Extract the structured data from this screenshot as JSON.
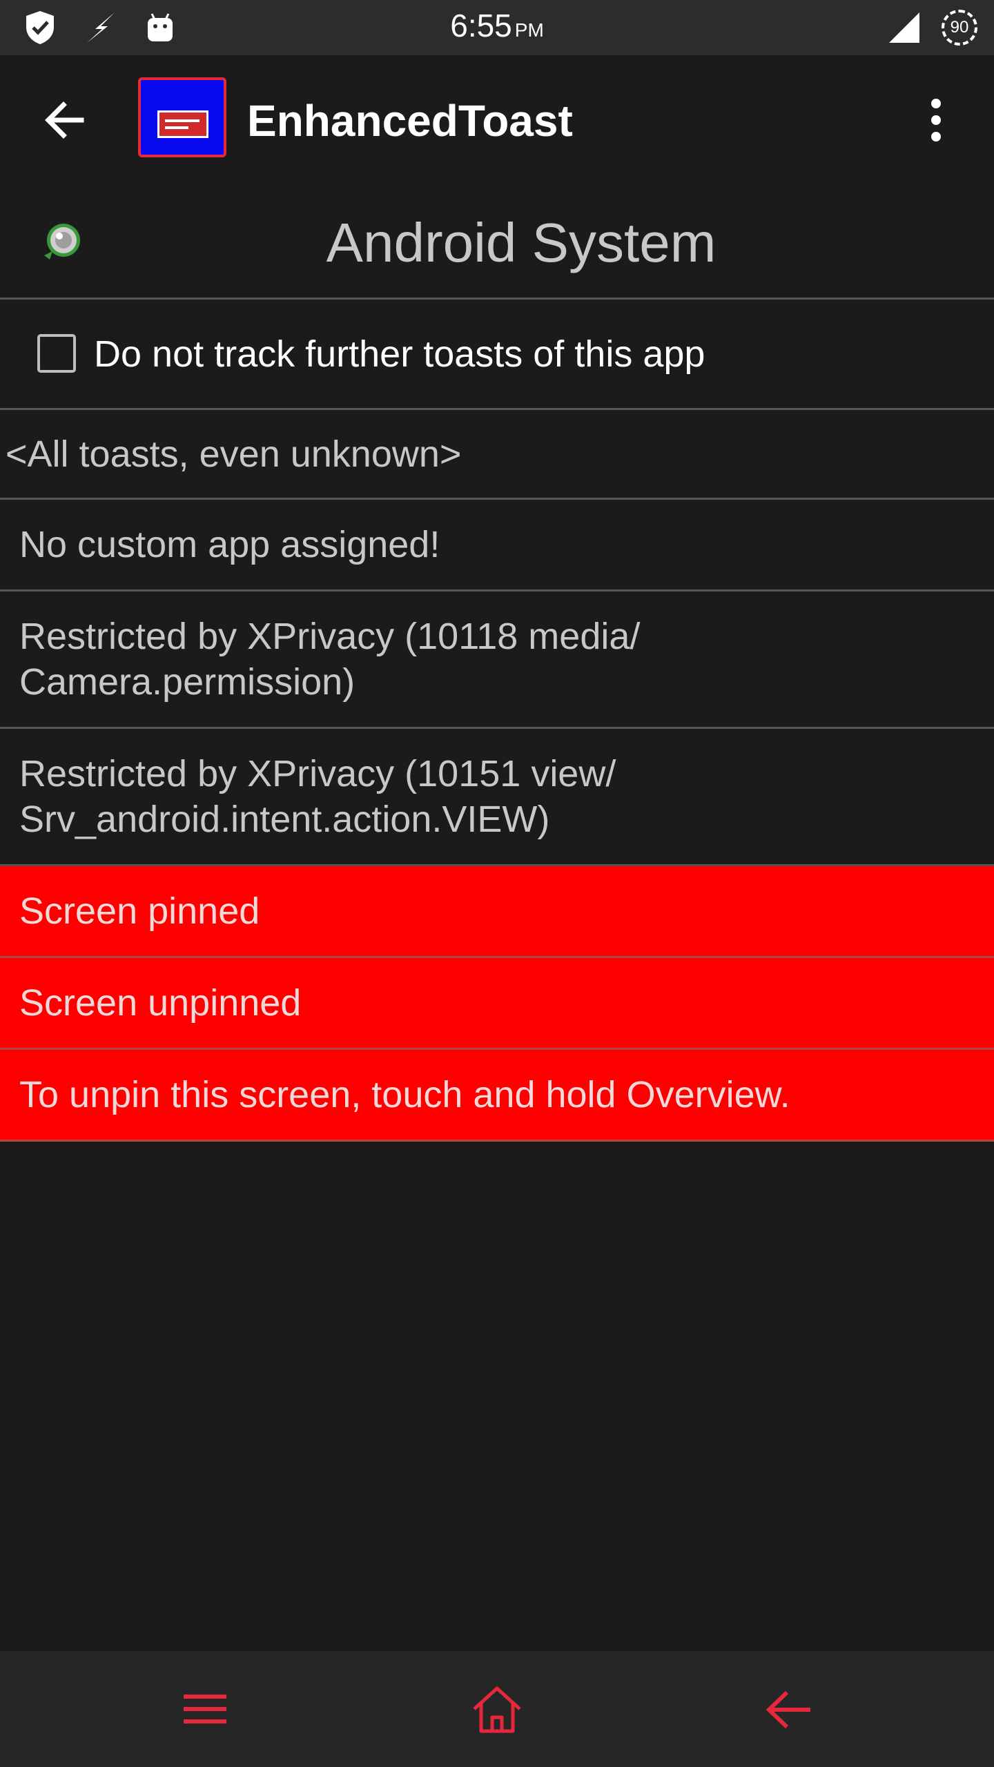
{
  "status_bar": {
    "time": "6:55",
    "ampm": "PM",
    "battery": "90",
    "icons": [
      "shield-check-icon",
      "lightning-icon",
      "android-icon",
      "cell-signal-icon",
      "battery-icon"
    ]
  },
  "app_bar": {
    "title": "EnhancedToast",
    "back_icon": "arrow-back-icon",
    "overflow_icon": "more-vert-icon"
  },
  "header": {
    "title": "Android System",
    "icon": "android-system-icon"
  },
  "tracking": {
    "label": "Do not track further toasts of this app",
    "checked": false
  },
  "list": {
    "all_toasts": "<All toasts, even unknown>",
    "no_custom_app": "No custom app assigned!",
    "restricted_1": "Restricted by XPrivacy (10118 media/ Camera.permission)",
    "restricted_2": "Restricted by XPrivacy (10151 view/ Srv_android.intent.action.VIEW)",
    "screen_pinned": "Screen pinned",
    "screen_unpinned": "Screen unpinned",
    "unpin_hint": "To unpin this screen, touch and hold Overview."
  },
  "bottom_nav": {
    "icons": [
      "menu-icon",
      "home-icon",
      "back-arrow-icon"
    ],
    "accent_color": "#e5283c"
  },
  "colors": {
    "background": "#1b1b1b",
    "highlight_row": "#ff0000",
    "divider": "#555555"
  }
}
